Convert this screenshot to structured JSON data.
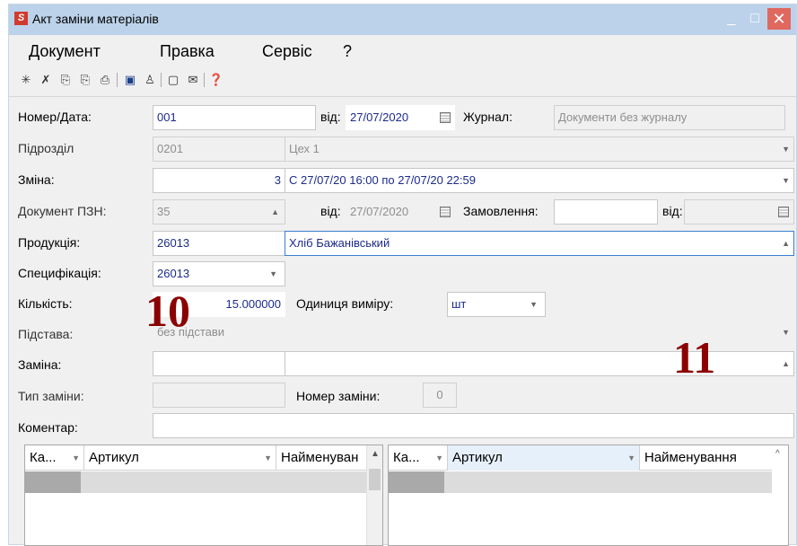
{
  "window": {
    "title": "Акт заміни матеріалів",
    "app_icon_text": "S",
    "min_glyph": "_",
    "max_glyph": "□",
    "close_glyph": "✕"
  },
  "menu": [
    "Документ",
    "Правка",
    "Сервіс",
    "?"
  ],
  "toolbar_icons": [
    "new-doc-icon",
    "delete-doc-icon",
    "copy-doc-icon",
    "copy-doc2-icon",
    "print-icon",
    "save-icon",
    "tree-icon",
    "form-icon",
    "mail-icon",
    "help-icon"
  ],
  "form": {
    "number_date_label": "Номер/Дата:",
    "number": "001",
    "vid_label": "від:",
    "date": "27/07/2020",
    "journal_label": "Журнал:",
    "journal": "Документи без журналу",
    "department_label": "Підрозділ",
    "department_code": "0201",
    "department_name": "Цех 1",
    "shift_label": "Зміна:",
    "shift_number": "3",
    "shift_period": "С 27/07/20 16:00 по 27/07/20 22:59",
    "pzn_label": "Документ ПЗН:",
    "pzn_number": "35",
    "pzn_vid_label": "від:",
    "pzn_date": "27/07/2020",
    "order_label": "Замовлення:",
    "order_value": "",
    "order_vid_label": "від:",
    "order_date": "",
    "product_label": "Продукція:",
    "product_code": "26013",
    "product_name": "Хліб Бажанівський",
    "spec_label": "Специфікація:",
    "spec_value": "26013",
    "qty_label": "Кількість:",
    "qty_value": "15.000000",
    "unit_label": "Одиниця виміру:",
    "unit_value": "шт",
    "basis_label": "Підстава:",
    "basis_value": "без підстави",
    "replacement_label": "Заміна:",
    "replacement_code": "",
    "replacement_name": "",
    "repl_type_label": "Тип заміни:",
    "repl_type_value": "",
    "repl_number_label": "Номер заміни:",
    "repl_number_value": "0",
    "comment_label": "Коментар:",
    "comment_value": ""
  },
  "annotations": {
    "left": "10",
    "right": "11"
  },
  "grid_left": {
    "columns": [
      "Ка...",
      "Артикул",
      "Найменуван"
    ]
  },
  "grid_right": {
    "columns": [
      "Ка...",
      "Артикул",
      "Найменування"
    ]
  },
  "colors": {
    "titlebar": "#bcd2ea",
    "close_button": "#e0685f",
    "value_text": "#1c2b8c",
    "annotation": "#8b0000"
  }
}
